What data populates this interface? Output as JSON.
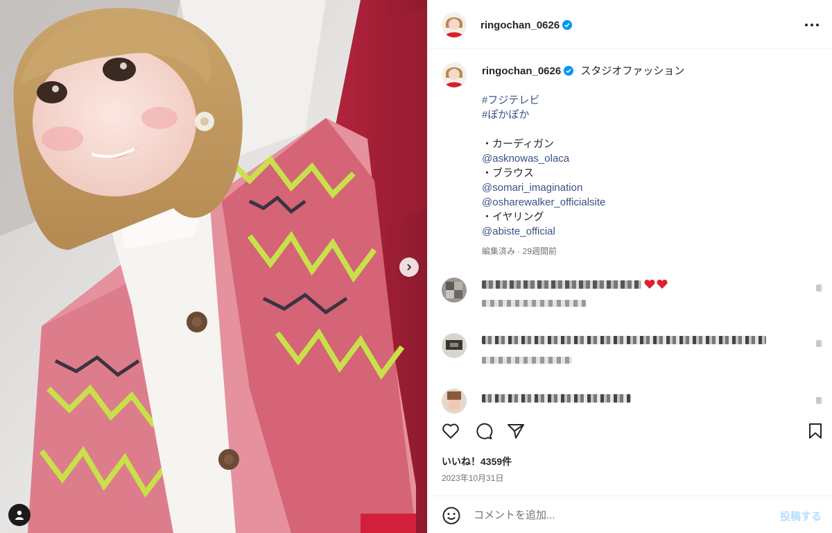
{
  "post": {
    "username": "ringochan_0626",
    "verified": true,
    "more_icon": "more-horizontal-icon"
  },
  "caption": {
    "title": "スタジオファッション",
    "hashtags": [
      "#フジテレビ",
      "#ぽかぽか"
    ],
    "items": [
      {
        "label": "・カーディガン",
        "links": [
          "@asknowas_olaca"
        ]
      },
      {
        "label": "・ブラウス",
        "links": [
          "@somari_imagination",
          "@osharewalker_officialsite"
        ]
      },
      {
        "label": "・イヤリング",
        "links": [
          "@abiste_official"
        ]
      }
    ],
    "meta": "編集済み · 29週間前"
  },
  "comments": [
    {
      "text_blurred": true,
      "hearts": 2
    },
    {
      "text_blurred": true,
      "hearts": 0
    },
    {
      "text_blurred": true,
      "hearts": 0
    }
  ],
  "actions": {
    "like_icon": "heart-icon",
    "comment_icon": "comment-icon",
    "share_icon": "paper-plane-icon",
    "save_icon": "bookmark-icon"
  },
  "likes_text": "いいね！4359件",
  "date_text": "2023年10月31日",
  "add_comment": {
    "placeholder": "コメントを追加...",
    "post_label": "投稿する"
  },
  "colors": {
    "link": "#385185",
    "verified": "#0095f6",
    "post_button_disabled": "#b2dffc",
    "heart_red": "#e0202f"
  }
}
